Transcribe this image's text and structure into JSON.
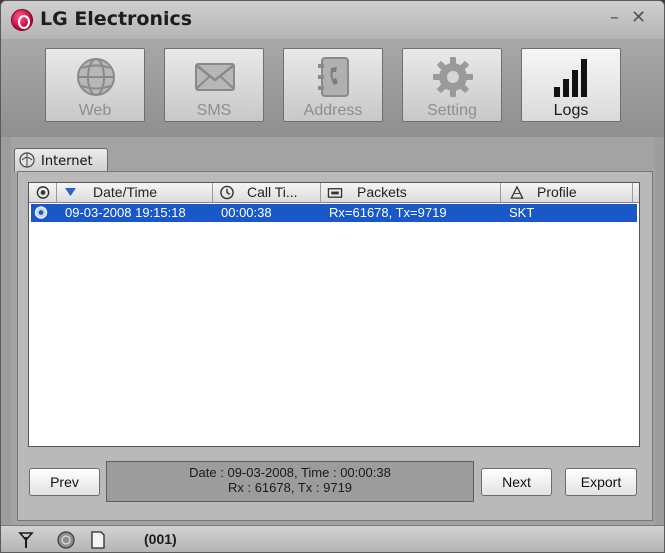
{
  "window": {
    "title": "LG Electronics",
    "minimize_glyph": "–",
    "close_glyph": "✕"
  },
  "toolbar": {
    "buttons": [
      {
        "label": "Web",
        "icon": "globe-icon",
        "active": false
      },
      {
        "label": "SMS",
        "icon": "envelope-icon",
        "active": false
      },
      {
        "label": "Address",
        "icon": "phonebook-icon",
        "active": false
      },
      {
        "label": "Setting",
        "icon": "gear-icon",
        "active": false
      },
      {
        "label": "Logs",
        "icon": "signal-bars-icon",
        "active": true
      }
    ]
  },
  "tabs": [
    {
      "label": "Internet",
      "icon": "internet-icon",
      "selected": true
    }
  ],
  "table": {
    "columns": [
      {
        "label": "",
        "icon": "connection-icon"
      },
      {
        "label": "Date/Time",
        "icon": "sort-desc-icon"
      },
      {
        "label": "Call Ti...",
        "icon": "call-time-icon"
      },
      {
        "label": "Packets",
        "icon": "packets-icon"
      },
      {
        "label": "Profile",
        "icon": "profile-icon"
      }
    ],
    "rows": [
      {
        "icon": "connection-icon",
        "datetime": "09-03-2008 19:15:18",
        "call_time": "00:00:38",
        "packets": "Rx=61678, Tx=9719",
        "profile": "SKT",
        "selected": true
      }
    ]
  },
  "details": {
    "line1": "Date : 09-03-2008, Time : 00:00:38",
    "line2": "Rx : 61678, Tx : 9719"
  },
  "buttons": {
    "prev": "Prev",
    "next": "Next",
    "export": "Export"
  },
  "status": {
    "count": "(001)",
    "icons": [
      "antenna-icon",
      "globe-status-icon",
      "memory-card-icon"
    ]
  },
  "colors": {
    "accent": "#1a57c8",
    "brand": "#c8004b"
  }
}
